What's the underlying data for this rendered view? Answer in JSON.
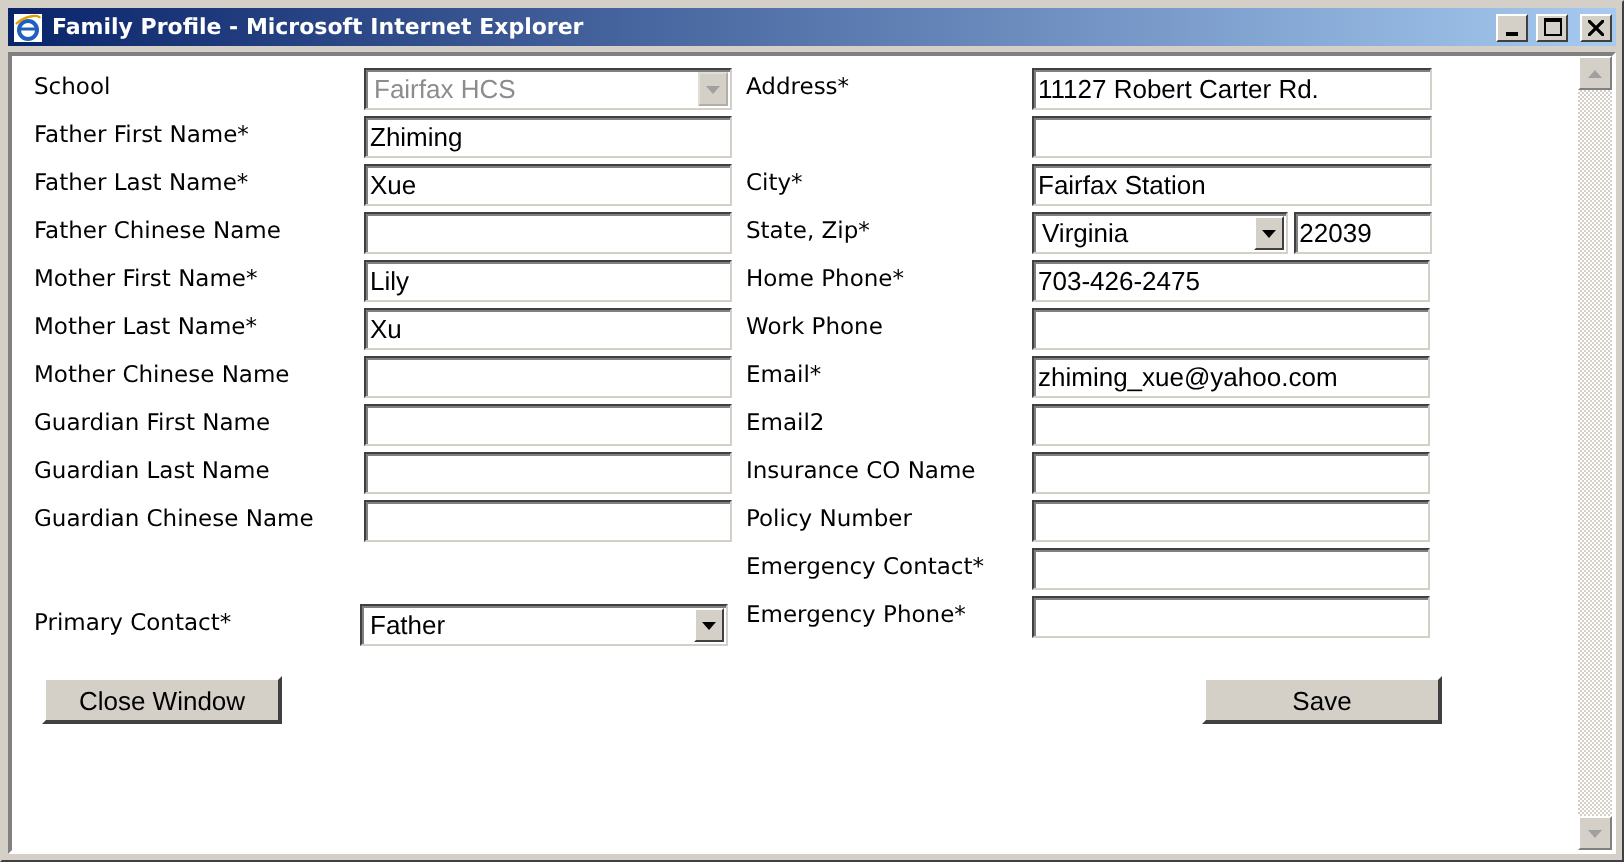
{
  "window": {
    "title": "Family Profile - Microsoft Internet Explorer"
  },
  "left_fields": [
    {
      "label": "School",
      "kind": "select",
      "value": "Fairfax HCS",
      "disabled": true
    },
    {
      "label": "Father First Name*",
      "kind": "text",
      "value": "Zhiming"
    },
    {
      "label": "Father Last Name*",
      "kind": "text",
      "value": "Xue"
    },
    {
      "label": "Father Chinese Name",
      "kind": "text"
    },
    {
      "label": "Mother First Name*",
      "kind": "text",
      "value": "Lily"
    },
    {
      "label": "Mother Last Name*",
      "kind": "text",
      "value": "Xu"
    },
    {
      "label": "Mother Chinese Name",
      "kind": "text"
    },
    {
      "label": "Guardian First Name",
      "kind": "text"
    },
    {
      "label": "Guardian Last Name",
      "kind": "text"
    },
    {
      "label": "Guardian Chinese Name",
      "kind": "text"
    }
  ],
  "primary_contact": {
    "label": "Primary Contact*",
    "kind": "select",
    "value": "Father",
    "disabled": false
  },
  "right_fields": [
    {
      "label": "Address*",
      "kind": "text",
      "value": "11127 Robert Carter Rd."
    },
    {
      "kind": "text"
    },
    {
      "label": "City*",
      "kind": "text",
      "value": "Fairfax Station"
    },
    {
      "label": "State, Zip*",
      "kind": "select_and_text",
      "value": "Virginia",
      "zip": "22039"
    },
    {
      "label": "Home Phone*",
      "kind": "text",
      "value": "703-426-2475"
    },
    {
      "label": "Work Phone",
      "kind": "text"
    },
    {
      "label": "Email*",
      "kind": "text",
      "value": "zhiming_xue@yahoo.com"
    },
    {
      "label": "Email2",
      "kind": "text"
    },
    {
      "label": "Insurance CO Name",
      "kind": "text"
    },
    {
      "label": "Policy Number",
      "kind": "text"
    },
    {
      "label": "Emergency Contact*",
      "kind": "text"
    },
    {
      "label": "Emergency Phone*",
      "kind": "text"
    }
  ],
  "buttons": [
    {
      "label": "Close Window",
      "kind": "close"
    },
    {
      "label": "Save",
      "kind": "save"
    }
  ]
}
